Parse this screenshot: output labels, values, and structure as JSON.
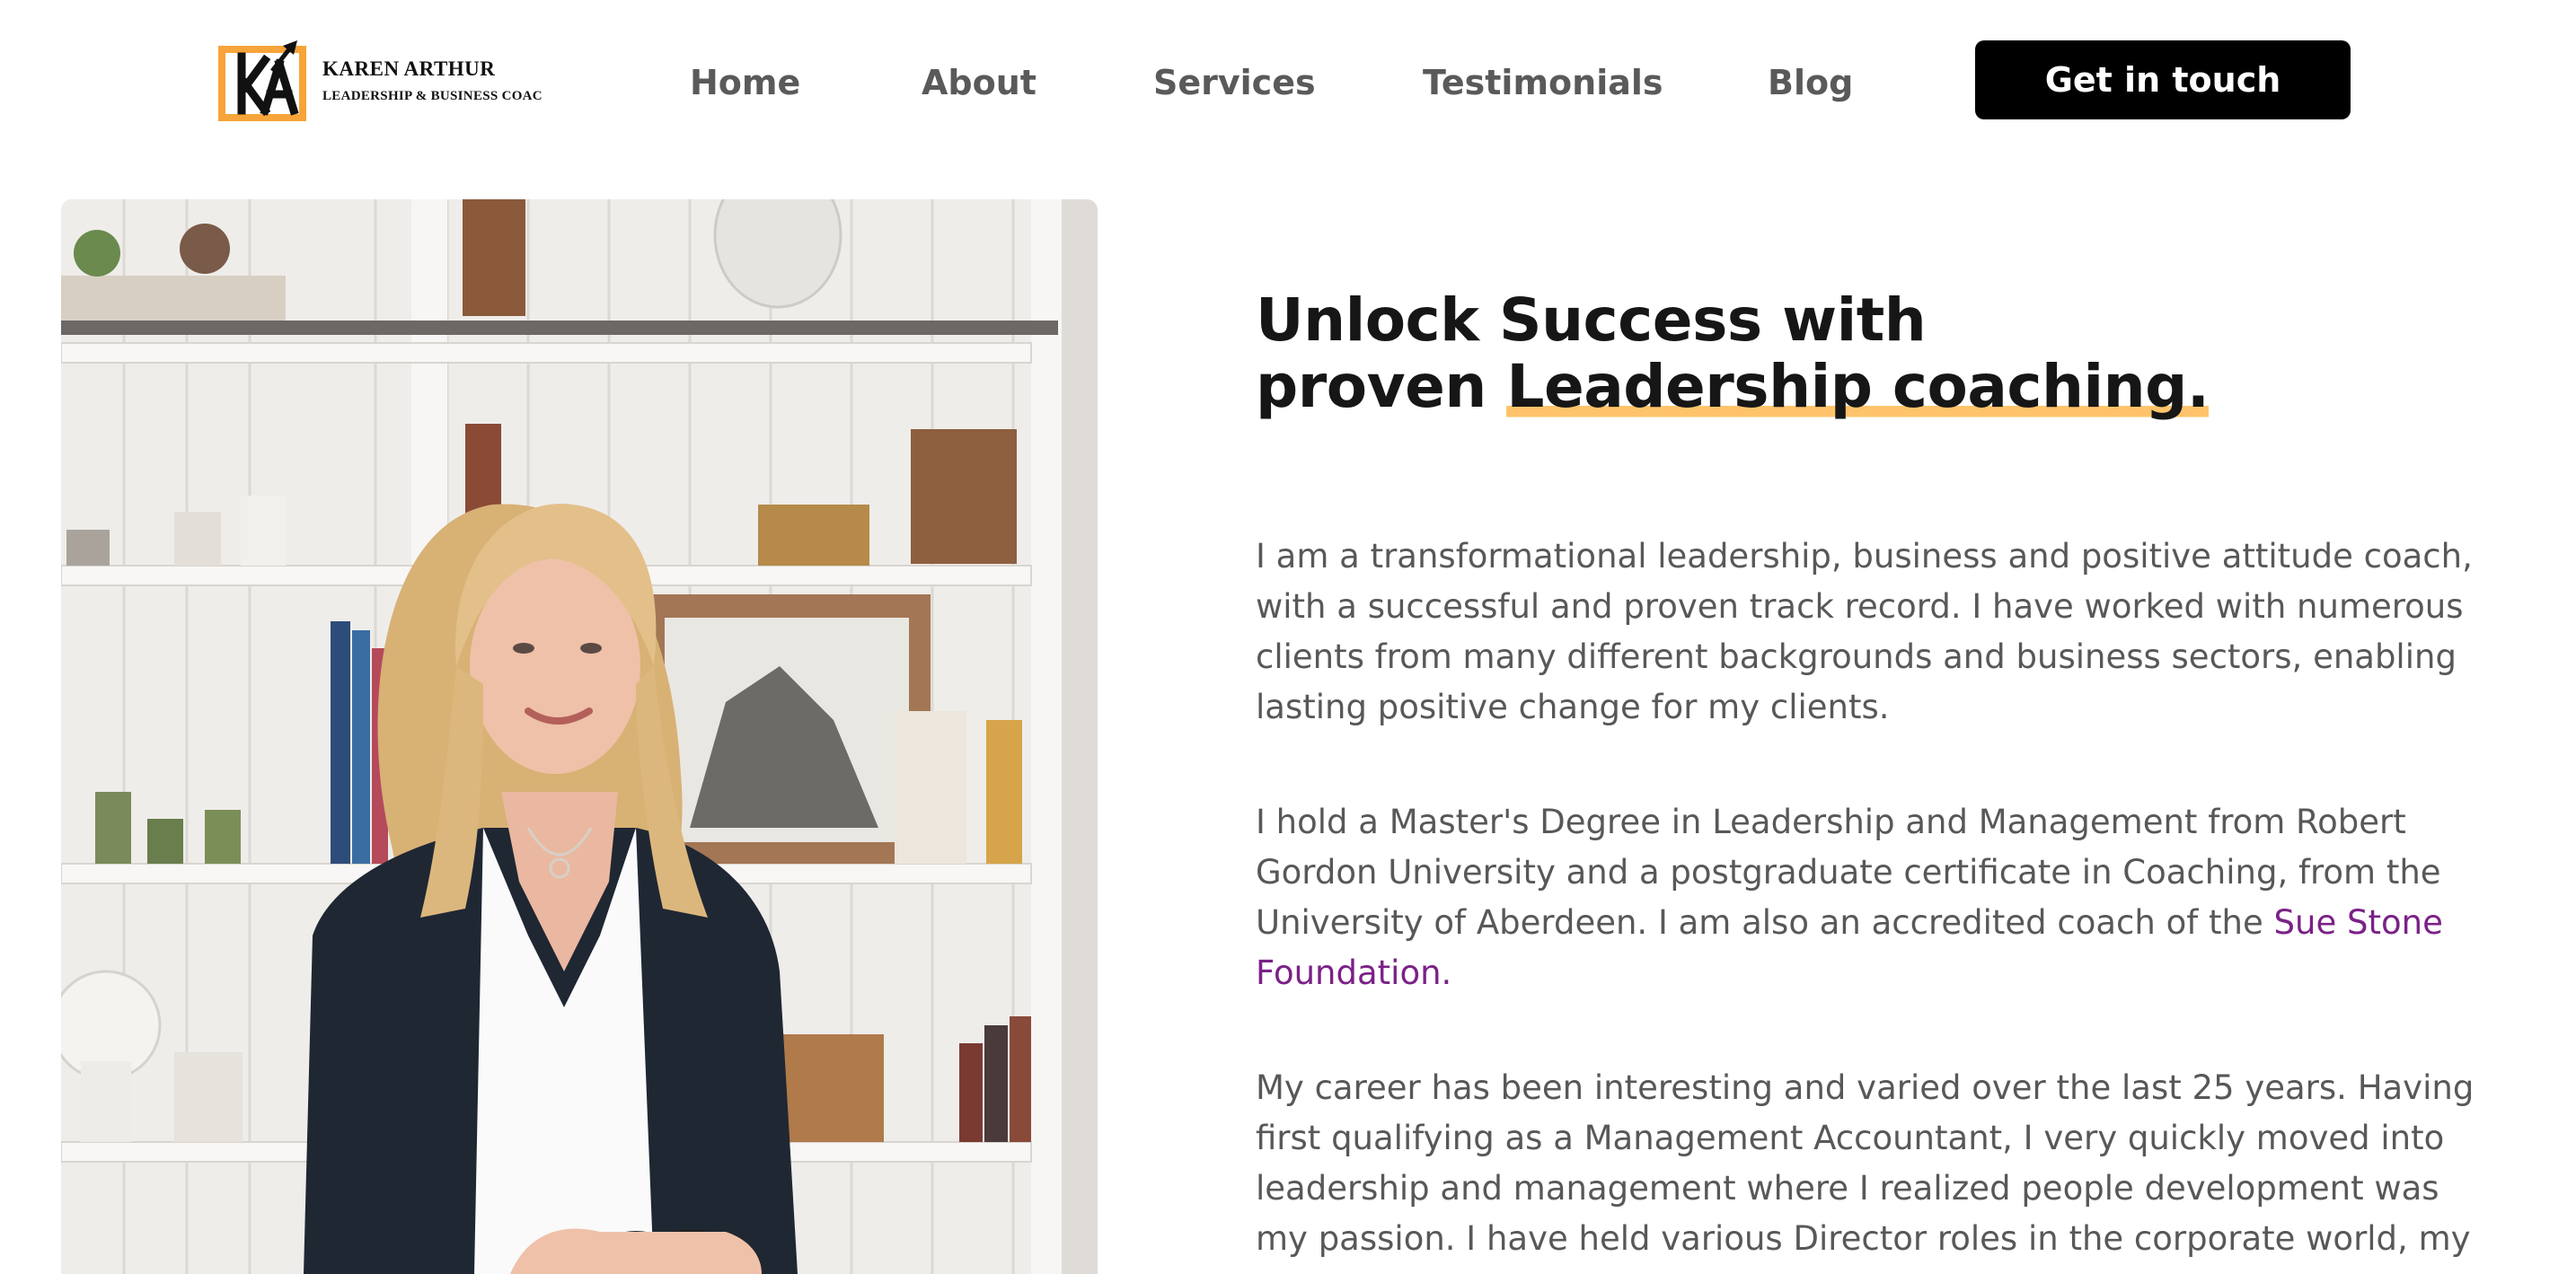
{
  "brand": {
    "monogram": "KA",
    "name": "KAREN ARTHUR",
    "tagline": "LEADERSHIP & BUSINESS COAC",
    "accent": "#f7a43a"
  },
  "nav": {
    "items": [
      "Home",
      "About",
      "Services",
      "Testimonials",
      "Blog"
    ],
    "cta_label": "Get in touch"
  },
  "hero": {
    "photo_icon": "portrait-photo",
    "headline_line1": "Unlock Success with",
    "headline_line2_pre": "proven ",
    "headline_line2_highlight": "Leadership coaching.",
    "highlight_color": "#ffc46b",
    "para1": "I am a transformational leadership, business and positive attitude coach, with a successful and proven track record. I have worked with numerous clients from many different backgrounds and business sectors, enabling lasting positive change for my clients.",
    "para2_text": "I hold a Master's Degree in Leadership and Management from Robert Gordon University and a postgraduate certificate in Coaching, from the University of Aberdeen. I am also an accredited coach of the ",
    "para2_link": "Sue Stone Foundation.",
    "link_color": "#7b2187",
    "para3": "My career has been interesting and varied over the last 25 years. Having first qualifying as a Management Accountant, I very quickly moved into leadership and management where I realized people development was my passion. I have held various Director roles in the corporate world, my"
  }
}
